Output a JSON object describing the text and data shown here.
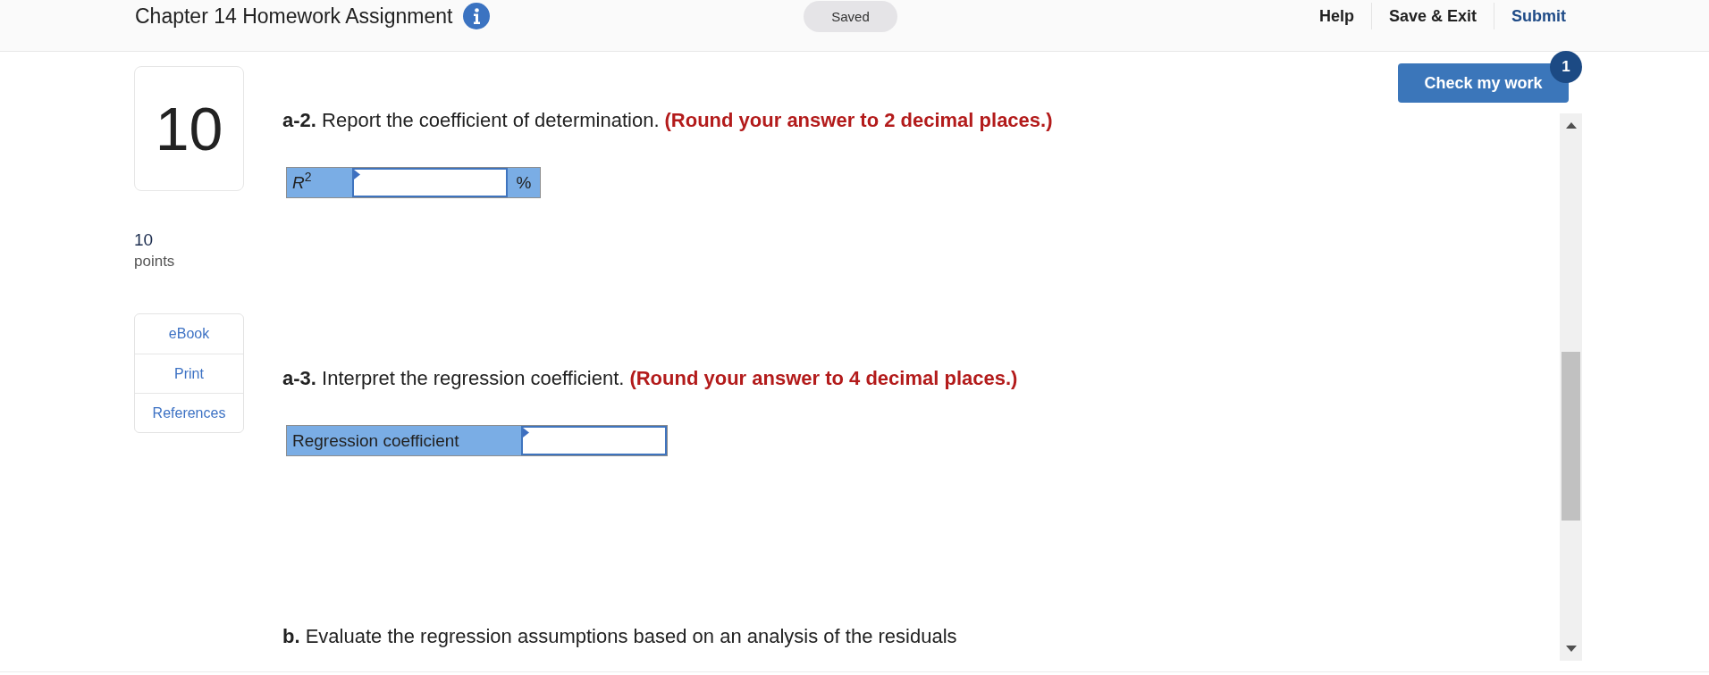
{
  "header": {
    "title": "Chapter 14 Homework Assignment",
    "status": "Saved",
    "nav": [
      {
        "label": "Help",
        "kind": "plain"
      },
      {
        "label": "Save & Exit",
        "kind": "plain"
      },
      {
        "label": "Submit",
        "kind": "primary"
      }
    ]
  },
  "question": {
    "number": "10",
    "points": "10",
    "points_label": "points",
    "tools": [
      "eBook",
      "Print",
      "References"
    ]
  },
  "check_work": {
    "label": "Check my work",
    "badge": "1"
  },
  "parts": [
    {
      "prompt": "**a-2.** Report the coefficient of determination.",
      "instruction": "(Round your answer to 2 decimal places.)",
      "answer": {
        "label": "*R*$^{2}$",
        "unit": "%"
      }
    },
    {
      "prompt": "**a-3.** Interpret the regression coefficient.",
      "instruction": "(Round your answer to 4 decimal places.)",
      "answer": {
        "label": "Regression coefficient"
      }
    },
    {
      "prompt": "**b.** Evaluate the regression assumptions based on an analysis of the residuals"
    }
  ]
}
